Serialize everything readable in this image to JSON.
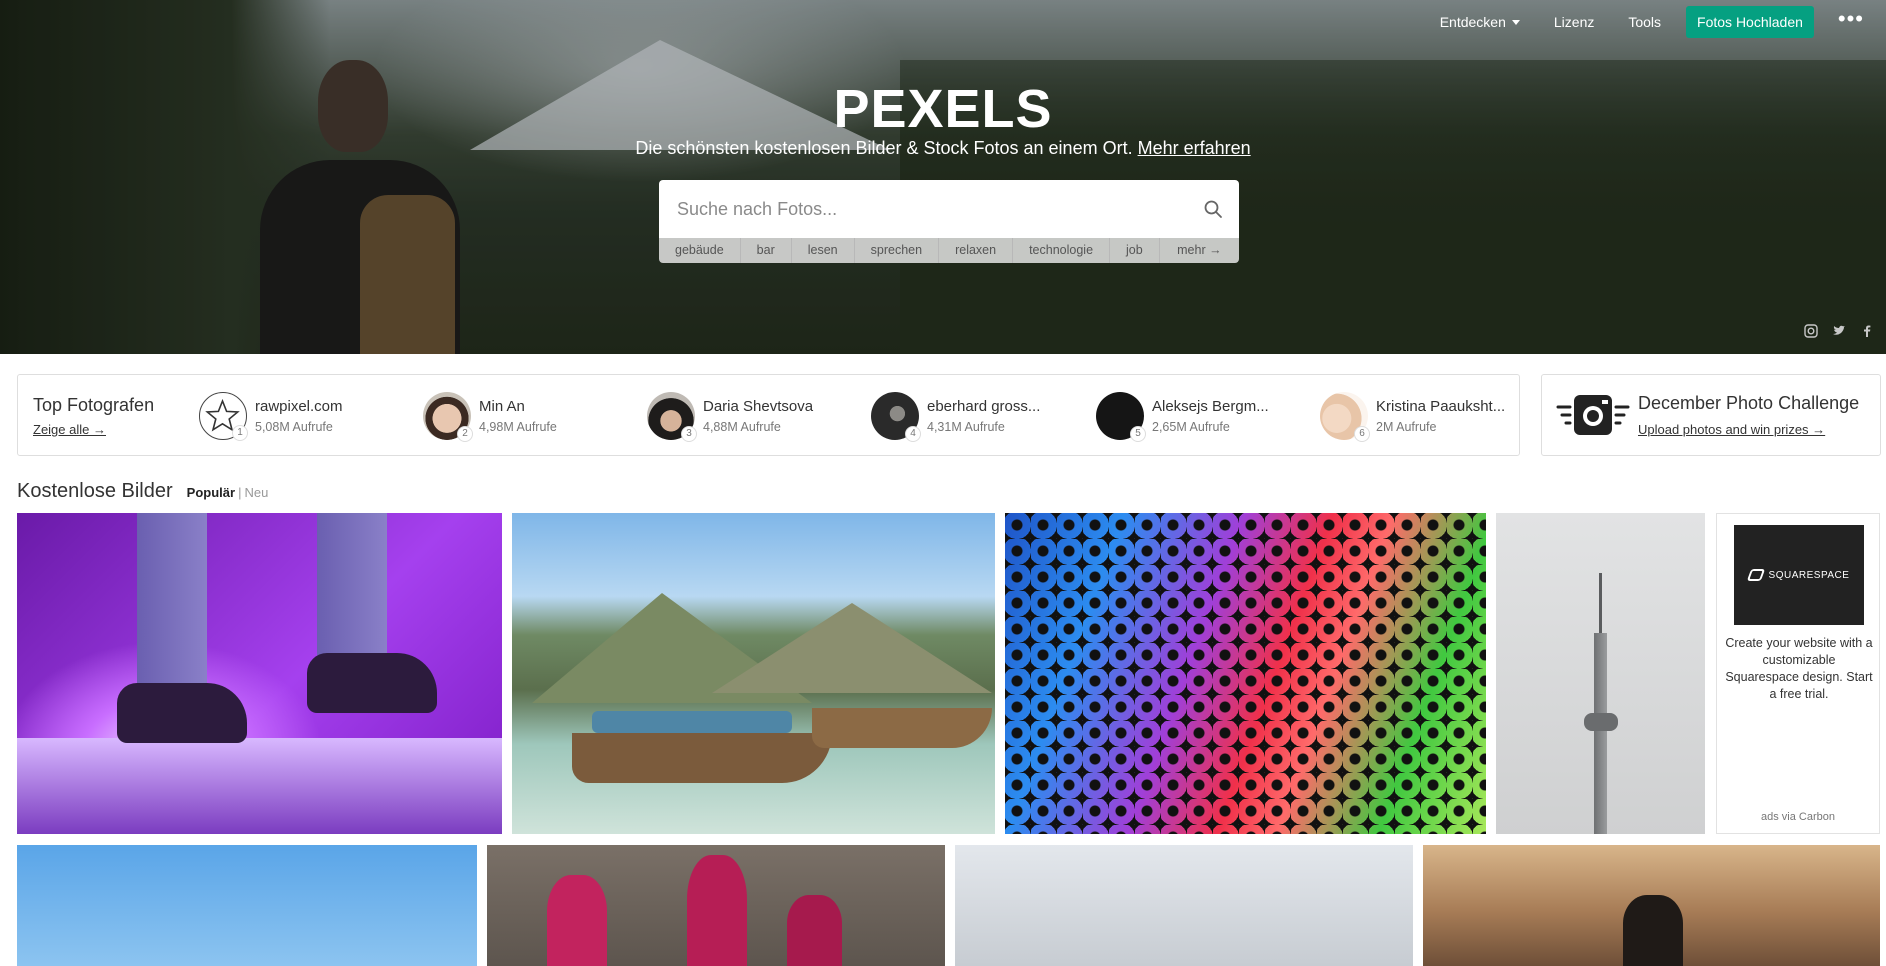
{
  "nav": {
    "discover": "Entdecken",
    "license": "Lizenz",
    "tools": "Tools",
    "upload": "Fotos Hochladen",
    "more": "•••"
  },
  "hero": {
    "logo": "PEXELS",
    "subtitle": "Die schönsten kostenlosen Bilder & Stock Fotos an einem Ort.",
    "learn_more": "Mehr erfahren",
    "search_placeholder": "Suche nach Fotos...",
    "tags": [
      "gebäude",
      "bar",
      "lesen",
      "sprechen",
      "relaxen",
      "technologie",
      "job",
      "mehr →"
    ]
  },
  "top_photographers": {
    "title": "Top Fotografen",
    "show_all": "Zeige alle →",
    "list": [
      {
        "rank": "1",
        "name": "rawpixel.com",
        "views": "5,08M Aufrufe"
      },
      {
        "rank": "2",
        "name": "Min An",
        "views": "4,98M Aufrufe"
      },
      {
        "rank": "3",
        "name": "Daria Shevtsova",
        "views": "4,88M Aufrufe"
      },
      {
        "rank": "4",
        "name": "eberhard gross...",
        "views": "4,31M Aufrufe"
      },
      {
        "rank": "5",
        "name": "Aleksejs Bergm...",
        "views": "2,65M Aufrufe"
      },
      {
        "rank": "6",
        "name": "Kristina Paauksht...",
        "views": "2M Aufrufe"
      }
    ]
  },
  "challenge": {
    "title": "December Photo Challenge",
    "link": "Upload photos and win prizes →"
  },
  "section": {
    "title": "Kostenlose Bilder",
    "tab_popular": "Populär",
    "separator": "|",
    "tab_new": "Neu"
  },
  "ad": {
    "brand": "SQUARESPACE",
    "text": "Create your website with a customizable Squarespace design. Start a free trial.",
    "via": "ads via Carbon"
  },
  "colors": {
    "accent": "#05a081"
  }
}
